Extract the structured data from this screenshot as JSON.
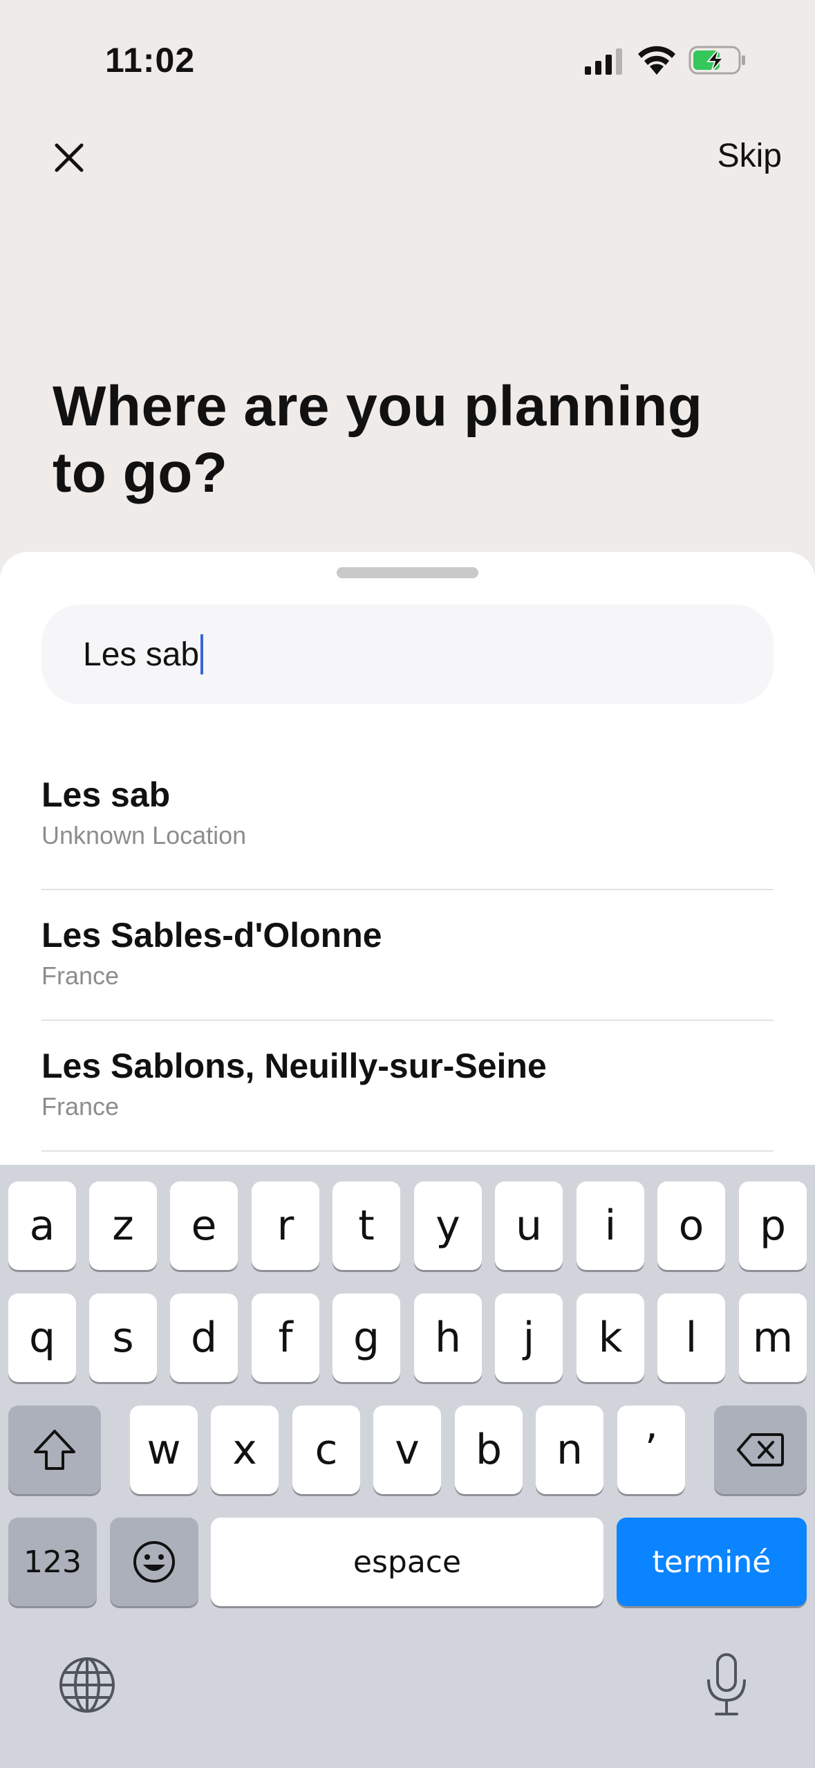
{
  "status_bar": {
    "time": "11:02"
  },
  "header": {
    "close_icon": "close-icon",
    "skip_label": "Skip"
  },
  "title": "Where are you planning to go?",
  "search": {
    "value": "Les sab"
  },
  "results": [
    {
      "title": "Les sab",
      "subtitle": "Unknown Location"
    },
    {
      "title": "Les Sables-d'Olonne",
      "subtitle": "France"
    },
    {
      "title": "Les Sablons, Neuilly-sur-Seine",
      "subtitle": "France"
    }
  ],
  "keyboard": {
    "row1": [
      "a",
      "z",
      "e",
      "r",
      "t",
      "y",
      "u",
      "i",
      "o",
      "p"
    ],
    "row2": [
      "q",
      "s",
      "d",
      "f",
      "g",
      "h",
      "j",
      "k",
      "l",
      "m"
    ],
    "row3": [
      "w",
      "x",
      "c",
      "v",
      "b",
      "n",
      "’"
    ],
    "numbers_label": "123",
    "space_label": "espace",
    "return_label": "terminé",
    "accent_color": "#0b84ff"
  }
}
